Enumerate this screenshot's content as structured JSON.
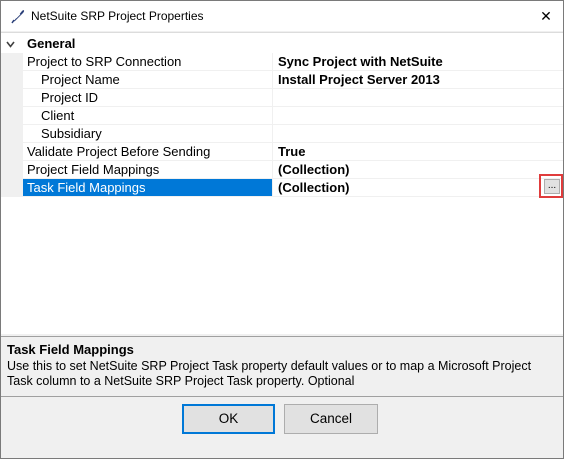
{
  "window": {
    "title": "NetSuite SRP Project Properties",
    "icon": "netsuite-feather-icon",
    "close_glyph": "✕"
  },
  "grid": {
    "category": {
      "label": "General",
      "expander": "collapse-chevron-icon",
      "expanded": true
    },
    "rows": [
      {
        "name": "Project to SRP Connection",
        "value": "Sync Project with NetSuite",
        "indent": 0
      },
      {
        "name": "Project Name",
        "value": "Install Project Server 2013",
        "indent": 1
      },
      {
        "name": "Project ID",
        "value": "",
        "indent": 1
      },
      {
        "name": "Client",
        "value": "",
        "indent": 1
      },
      {
        "name": "Subsidiary",
        "value": "",
        "indent": 1
      },
      {
        "name": "Validate Project Before Sending",
        "value": "True",
        "indent": 0
      },
      {
        "name": "Project Field Mappings",
        "value": "(Collection)",
        "indent": 0
      },
      {
        "name": "Task Field Mappings",
        "value": "(Collection)",
        "indent": 0,
        "selected": true
      }
    ],
    "ellipsis_label": "...",
    "selection_color": "#0078d7",
    "highlight_color": "#e03c3c"
  },
  "description": {
    "title": "Task Field Mappings",
    "text": "Use this to set NetSuite SRP Project Task property default values or to map a Microsoft Project Task column to a NetSuite SRP Project Task property. Optional"
  },
  "buttons": {
    "ok": "OK",
    "cancel": "Cancel"
  }
}
